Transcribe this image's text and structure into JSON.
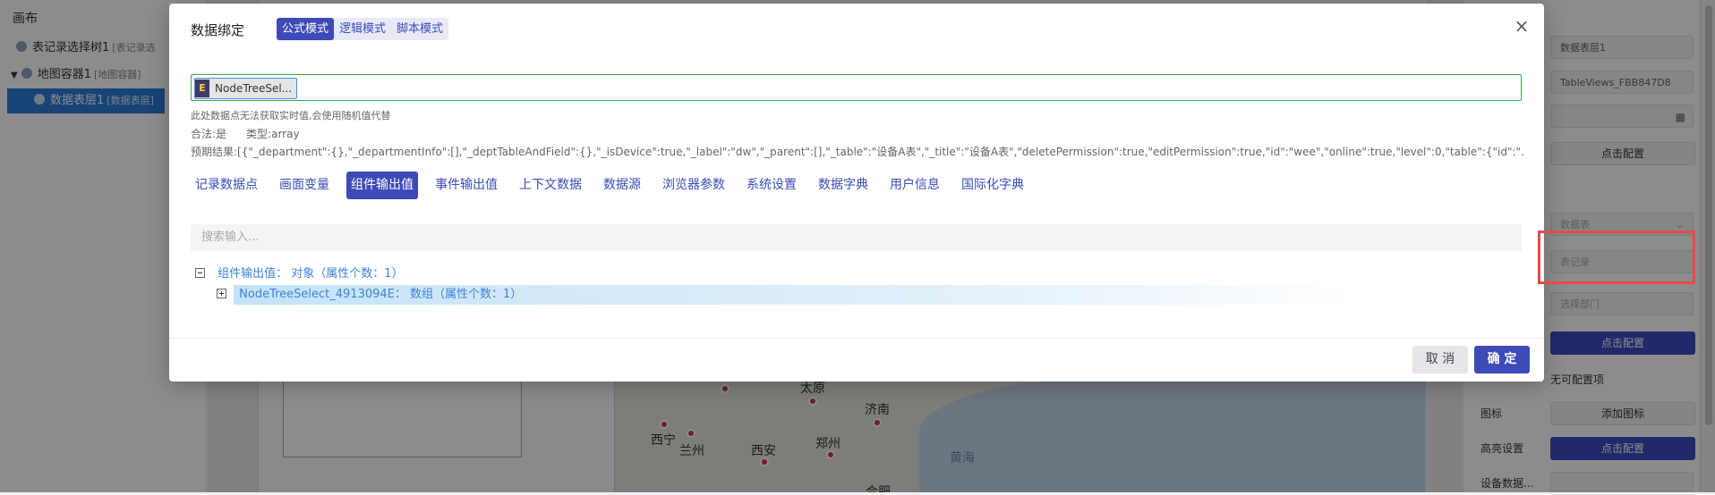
{
  "left_panel": {
    "title": "画布",
    "tree": [
      {
        "label": "表记录选择树1",
        "sub": "[表记录选"
      },
      {
        "label": "地图容器1",
        "sub": "[地图容器]"
      },
      {
        "label": "数据表层1",
        "sub": "[数据表层]"
      }
    ]
  },
  "map": {
    "labels": [
      "太原",
      "济南",
      "西宁",
      "兰州",
      "西安",
      "郑州",
      "黄海",
      "合肥"
    ]
  },
  "right_panel": {
    "fields": [
      "数据表层1",
      "TableViews_FBB847D8",
      "",
      "数据表",
      "表记录",
      "选择部门"
    ],
    "buttons": [
      "点击配置",
      "点击配置",
      "添加图标",
      "点击配置"
    ],
    "labels": [
      "图标",
      "高亮设置",
      "设备数据..."
    ],
    "no_config_text": "无可配置项"
  },
  "modal": {
    "title": "数据绑定",
    "modes": [
      "公式模式",
      "逻辑模式",
      "脚本模式"
    ],
    "close_glyph": "×",
    "token_icon": "E",
    "token_text": "NodeTreeSel...",
    "hint": "此处数据点无法获取实时值,会使用随机值代替",
    "legal": "合法:是",
    "type": "类型:array",
    "predict": "预期结果:[{\"_department\":{},\"_departmentInfo\":[],\"_deptTableAndField\":{},\"_isDevice\":true,\"_label\":\"dw\",\"_parent\":[],\"_table\":\"设备A表\",\"_title\":\"设备A表\",\"deletePermission\":true,\"editPermission\":true,\"id\":\"wee\",\"online\":true,\"level\":0,\"table\":{\"id\":\"...",
    "tabs": [
      "记录数据点",
      "画面变量",
      "组件输出值",
      "事件输出值",
      "上下文数据",
      "数据源",
      "浏览器参数",
      "系统设置",
      "数据字典",
      "用户信息",
      "国际化字典"
    ],
    "active_tab": "组件输出值",
    "search_placeholder": "搜索输入...",
    "tree_root": {
      "name": "组件输出值：",
      "desc": "对象（属性个数：1）"
    },
    "tree_child": {
      "name": "NodeTreeSelect_4913094E：",
      "desc": "数组（属性个数：1）"
    },
    "cancel": "取 消",
    "ok": "确 定"
  },
  "colors": {
    "accent": "#3d4ab8",
    "highlight": "#e8494b",
    "valid_border": "#3aa74a"
  }
}
